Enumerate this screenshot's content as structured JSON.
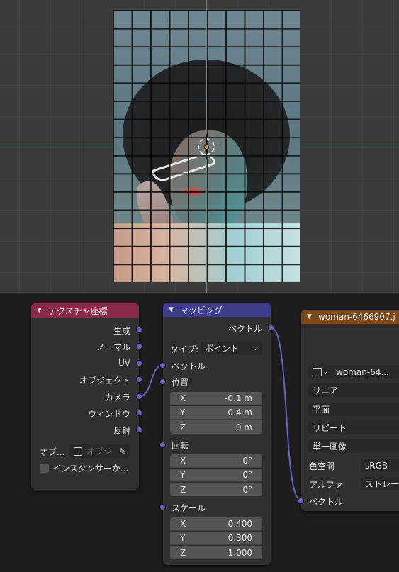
{
  "texture_coord_node": {
    "title": "テクスチャ座標",
    "outputs": [
      "生成",
      "ノーマル",
      "UV",
      "オブジェクト",
      "カメラ",
      "ウィンドウ",
      "反射"
    ],
    "object_label": "オブ...",
    "object_placeholder": "オブジ",
    "instancer_label": "インスタンサーか..."
  },
  "mapping_node": {
    "title": "マッピング",
    "output_vector": "ベクトル",
    "type_label": "タイプ:",
    "type_value": "ポイント",
    "input_vector": "ベクトル",
    "location_label": "位置",
    "location": [
      {
        "axis": "X",
        "value": "-0.1 m"
      },
      {
        "axis": "Y",
        "value": "0.4 m"
      },
      {
        "axis": "Z",
        "value": "0 m"
      }
    ],
    "rotation_label": "回転",
    "rotation": [
      {
        "axis": "X",
        "value": "0°"
      },
      {
        "axis": "Y",
        "value": "0°"
      },
      {
        "axis": "Z",
        "value": "0°"
      }
    ],
    "scale_label": "スケール",
    "scale": [
      {
        "axis": "X",
        "value": "0.400"
      },
      {
        "axis": "Y",
        "value": "0.300"
      },
      {
        "axis": "Z",
        "value": "1.000"
      }
    ]
  },
  "image_texture_node": {
    "title": "woman-6466907.j",
    "image_name": "woman-64...",
    "interpolation": "リニア",
    "projection": "平面",
    "extension": "リピート",
    "source": "単一画像",
    "color_space_label": "色空間",
    "color_space_value": "sRGB",
    "alpha_label": "アルファ",
    "alpha_value": "ストレー",
    "vector_input": "ベクトル"
  },
  "colors": {
    "texcoord_header": "#8a2a4a",
    "mapping_header": "#3d3d8c",
    "image_header": "#7a4a1c",
    "socket_vector": "#6363c7",
    "link": "#6363c7"
  }
}
